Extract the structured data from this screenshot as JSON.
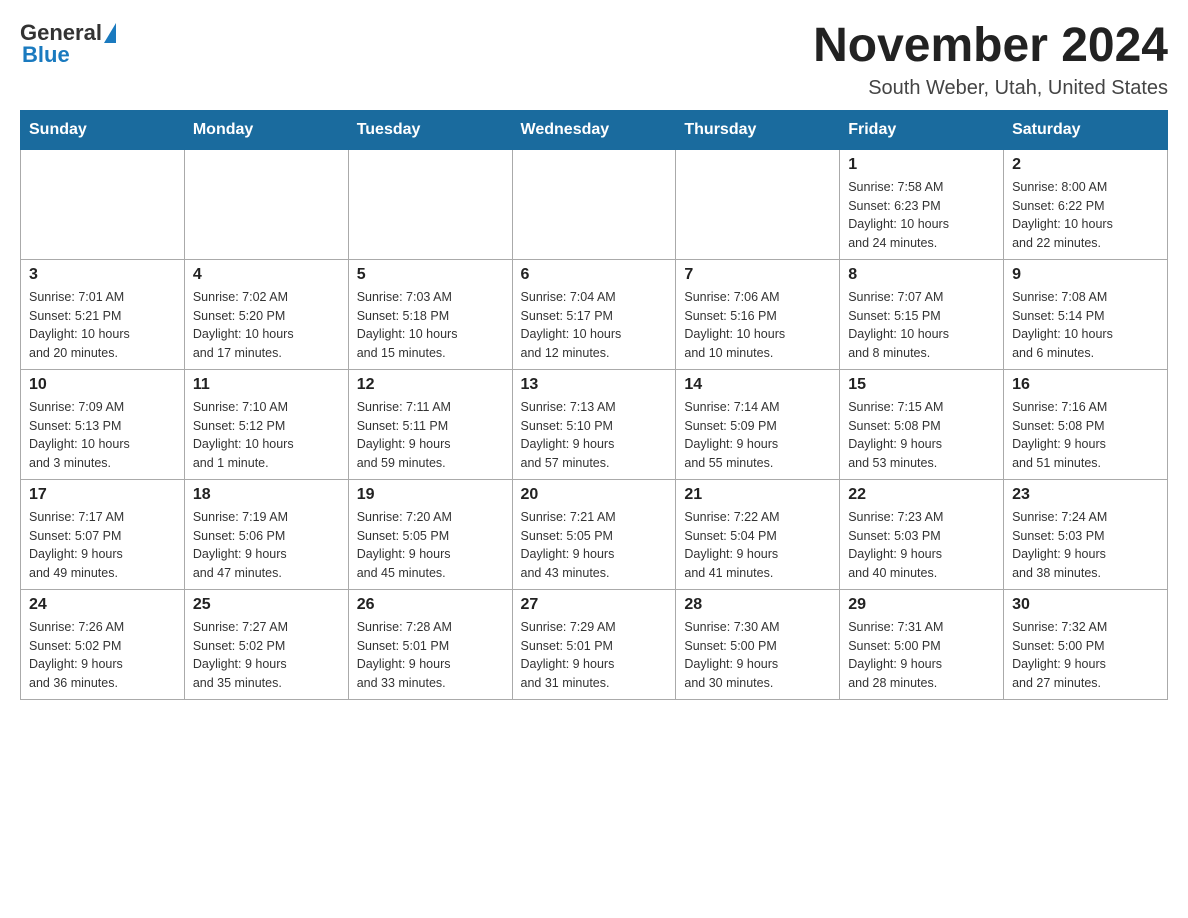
{
  "header": {
    "month_title": "November 2024",
    "location": "South Weber, Utah, United States",
    "logo_general": "General",
    "logo_blue": "Blue"
  },
  "days_of_week": [
    "Sunday",
    "Monday",
    "Tuesday",
    "Wednesday",
    "Thursday",
    "Friday",
    "Saturday"
  ],
  "weeks": [
    [
      {
        "day": "",
        "info": ""
      },
      {
        "day": "",
        "info": ""
      },
      {
        "day": "",
        "info": ""
      },
      {
        "day": "",
        "info": ""
      },
      {
        "day": "",
        "info": ""
      },
      {
        "day": "1",
        "info": "Sunrise: 7:58 AM\nSunset: 6:23 PM\nDaylight: 10 hours\nand 24 minutes."
      },
      {
        "day": "2",
        "info": "Sunrise: 8:00 AM\nSunset: 6:22 PM\nDaylight: 10 hours\nand 22 minutes."
      }
    ],
    [
      {
        "day": "3",
        "info": "Sunrise: 7:01 AM\nSunset: 5:21 PM\nDaylight: 10 hours\nand 20 minutes."
      },
      {
        "day": "4",
        "info": "Sunrise: 7:02 AM\nSunset: 5:20 PM\nDaylight: 10 hours\nand 17 minutes."
      },
      {
        "day": "5",
        "info": "Sunrise: 7:03 AM\nSunset: 5:18 PM\nDaylight: 10 hours\nand 15 minutes."
      },
      {
        "day": "6",
        "info": "Sunrise: 7:04 AM\nSunset: 5:17 PM\nDaylight: 10 hours\nand 12 minutes."
      },
      {
        "day": "7",
        "info": "Sunrise: 7:06 AM\nSunset: 5:16 PM\nDaylight: 10 hours\nand 10 minutes."
      },
      {
        "day": "8",
        "info": "Sunrise: 7:07 AM\nSunset: 5:15 PM\nDaylight: 10 hours\nand 8 minutes."
      },
      {
        "day": "9",
        "info": "Sunrise: 7:08 AM\nSunset: 5:14 PM\nDaylight: 10 hours\nand 6 minutes."
      }
    ],
    [
      {
        "day": "10",
        "info": "Sunrise: 7:09 AM\nSunset: 5:13 PM\nDaylight: 10 hours\nand 3 minutes."
      },
      {
        "day": "11",
        "info": "Sunrise: 7:10 AM\nSunset: 5:12 PM\nDaylight: 10 hours\nand 1 minute."
      },
      {
        "day": "12",
        "info": "Sunrise: 7:11 AM\nSunset: 5:11 PM\nDaylight: 9 hours\nand 59 minutes."
      },
      {
        "day": "13",
        "info": "Sunrise: 7:13 AM\nSunset: 5:10 PM\nDaylight: 9 hours\nand 57 minutes."
      },
      {
        "day": "14",
        "info": "Sunrise: 7:14 AM\nSunset: 5:09 PM\nDaylight: 9 hours\nand 55 minutes."
      },
      {
        "day": "15",
        "info": "Sunrise: 7:15 AM\nSunset: 5:08 PM\nDaylight: 9 hours\nand 53 minutes."
      },
      {
        "day": "16",
        "info": "Sunrise: 7:16 AM\nSunset: 5:08 PM\nDaylight: 9 hours\nand 51 minutes."
      }
    ],
    [
      {
        "day": "17",
        "info": "Sunrise: 7:17 AM\nSunset: 5:07 PM\nDaylight: 9 hours\nand 49 minutes."
      },
      {
        "day": "18",
        "info": "Sunrise: 7:19 AM\nSunset: 5:06 PM\nDaylight: 9 hours\nand 47 minutes."
      },
      {
        "day": "19",
        "info": "Sunrise: 7:20 AM\nSunset: 5:05 PM\nDaylight: 9 hours\nand 45 minutes."
      },
      {
        "day": "20",
        "info": "Sunrise: 7:21 AM\nSunset: 5:05 PM\nDaylight: 9 hours\nand 43 minutes."
      },
      {
        "day": "21",
        "info": "Sunrise: 7:22 AM\nSunset: 5:04 PM\nDaylight: 9 hours\nand 41 minutes."
      },
      {
        "day": "22",
        "info": "Sunrise: 7:23 AM\nSunset: 5:03 PM\nDaylight: 9 hours\nand 40 minutes."
      },
      {
        "day": "23",
        "info": "Sunrise: 7:24 AM\nSunset: 5:03 PM\nDaylight: 9 hours\nand 38 minutes."
      }
    ],
    [
      {
        "day": "24",
        "info": "Sunrise: 7:26 AM\nSunset: 5:02 PM\nDaylight: 9 hours\nand 36 minutes."
      },
      {
        "day": "25",
        "info": "Sunrise: 7:27 AM\nSunset: 5:02 PM\nDaylight: 9 hours\nand 35 minutes."
      },
      {
        "day": "26",
        "info": "Sunrise: 7:28 AM\nSunset: 5:01 PM\nDaylight: 9 hours\nand 33 minutes."
      },
      {
        "day": "27",
        "info": "Sunrise: 7:29 AM\nSunset: 5:01 PM\nDaylight: 9 hours\nand 31 minutes."
      },
      {
        "day": "28",
        "info": "Sunrise: 7:30 AM\nSunset: 5:00 PM\nDaylight: 9 hours\nand 30 minutes."
      },
      {
        "day": "29",
        "info": "Sunrise: 7:31 AM\nSunset: 5:00 PM\nDaylight: 9 hours\nand 28 minutes."
      },
      {
        "day": "30",
        "info": "Sunrise: 7:32 AM\nSunset: 5:00 PM\nDaylight: 9 hours\nand 27 minutes."
      }
    ]
  ]
}
